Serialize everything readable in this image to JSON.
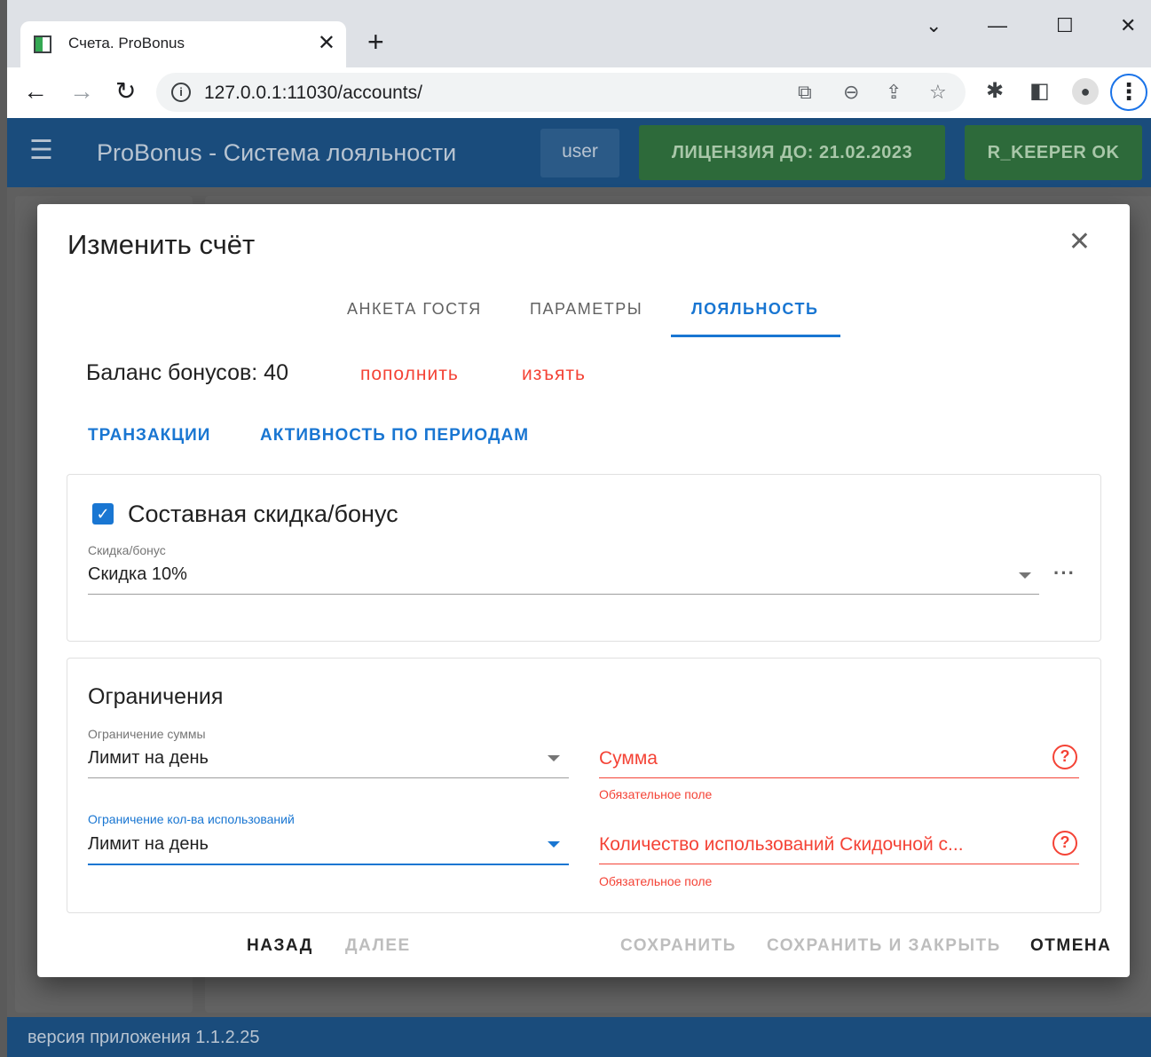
{
  "browser": {
    "tab_title": "Счета. ProBonus",
    "tab_close": "✕",
    "new_tab": "+",
    "url": "127.0.0.1:11030/accounts/",
    "info_icon": "i"
  },
  "app": {
    "title": "ProBonus - Система лояльности",
    "user": "user",
    "license": "ЛИЦЕНЗИЯ ДО: 21.02.2023",
    "rkeeper": "R_KEEPER OK",
    "version": "версия приложения 1.1.2.25"
  },
  "dialog": {
    "title": "Изменить счёт",
    "tabs": [
      "АНКЕТА ГОСТЯ",
      "ПАРАМЕТРЫ",
      "ЛОЯЛЬНОСТЬ"
    ],
    "active_tab": "ЛОЯЛЬНОСТЬ",
    "balance": "Баланс бонусов: 40",
    "topup": "пополнить",
    "withdraw": "изъять",
    "transactions": "ТРАНЗАКЦИИ",
    "activity": "АКТИВНОСТЬ ПО ПЕРИОДАМ",
    "composite": {
      "checked": true,
      "label": "Составная скидка/бонус",
      "field_label": "Скидка/бонус",
      "field_value": "Скидка 10%"
    },
    "limits": {
      "heading": "Ограничения",
      "sum_limit_label": "Ограничение суммы",
      "sum_limit_value": "Лимит на день",
      "sum_placeholder": "Сумма",
      "sum_error": "Обязательное поле",
      "usage_limit_label": "Ограничение кол-ва использований",
      "usage_limit_value": "Лимит на день",
      "usage_placeholder": "Количество использований Скидочной с...",
      "usage_error": "Обязательное поле"
    },
    "actions": {
      "back": "НАЗАД",
      "next": "ДАЛЕЕ",
      "save": "СОХРАНИТЬ",
      "save_close": "СОХРАНИТЬ И ЗАКРЫТЬ",
      "cancel": "ОТМЕНА"
    }
  },
  "colors": {
    "primary": "#1976d2",
    "error": "#f44336",
    "appbar": "#1a4c7c",
    "license_green": "#2d6a3a"
  }
}
